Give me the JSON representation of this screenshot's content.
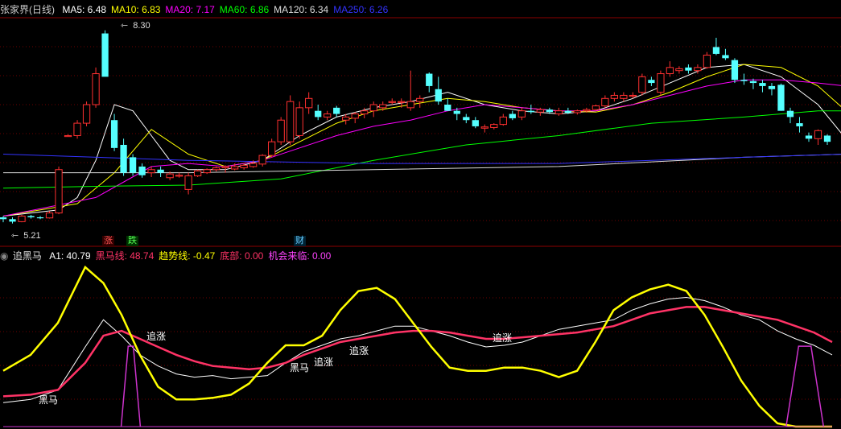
{
  "main_panel": {
    "title": "张家界(日线)",
    "indicators": [
      {
        "label": "MA5: 6.48",
        "color": "#ffffff"
      },
      {
        "label": "MA10: 6.83",
        "color": "#ffff00"
      },
      {
        "label": "MA20: 7.17",
        "color": "#ff00ff"
      },
      {
        "label": "MA60: 6.86",
        "color": "#00ff00"
      },
      {
        "label": "MA120: 6.34",
        "color": "#dddddd"
      },
      {
        "label": "MA250: 6.26",
        "color": "#3333ff"
      }
    ],
    "high_label": "8.30",
    "low_label": "5.21",
    "badges": [
      {
        "text": "涨",
        "color": "#ff5555",
        "bg": "#330000"
      },
      {
        "text": "跌",
        "color": "#55ff55",
        "bg": "#003300"
      },
      {
        "text": "财",
        "color": "#66ccff",
        "bg": "#002233"
      }
    ]
  },
  "sub_panel": {
    "title": "追黑马",
    "indicators": [
      {
        "label": "A1: 40.79",
        "color": "#ffffff"
      },
      {
        "label": "黑马线: 48.74",
        "color": "#ff3366"
      },
      {
        "label": "趋势线: -0.47",
        "color": "#ffff00"
      },
      {
        "label": "底部: 0.00",
        "color": "#ff3366"
      },
      {
        "label": "机会来临: 0.00",
        "color": "#ff44ff"
      }
    ],
    "annotations": [
      "黑马",
      "追涨",
      "黑马",
      "追涨",
      "追涨",
      "追涨"
    ]
  },
  "chart_data": [
    {
      "type": "candlestick",
      "ylim": [
        5.15,
        8.4
      ],
      "up_color": "#ff3030",
      "down_color": "#55ffff",
      "candles": [
        [
          5.28,
          5.3,
          5.2,
          5.25
        ],
        [
          5.25,
          5.28,
          5.18,
          5.21
        ],
        [
          5.21,
          5.32,
          5.2,
          5.3
        ],
        [
          5.3,
          5.32,
          5.26,
          5.28
        ],
        [
          5.28,
          5.3,
          5.25,
          5.27
        ],
        [
          5.27,
          5.38,
          5.26,
          5.35
        ],
        [
          5.35,
          6.1,
          5.33,
          6.05
        ],
        [
          6.6,
          6.62,
          6.58,
          6.6
        ],
        [
          6.6,
          6.85,
          6.55,
          6.8
        ],
        [
          6.8,
          7.15,
          6.75,
          7.1
        ],
        [
          7.1,
          7.7,
          7.05,
          7.6
        ],
        [
          8.25,
          8.3,
          7.85,
          7.55
        ],
        [
          6.85,
          6.95,
          6.35,
          6.4
        ],
        [
          6.45,
          6.55,
          5.95,
          6.0
        ],
        [
          6.25,
          6.3,
          5.95,
          6.0
        ],
        [
          6.1,
          6.15,
          5.92,
          5.96
        ],
        [
          6.0,
          6.1,
          5.93,
          6.05
        ],
        [
          6.05,
          6.1,
          5.93,
          6.0
        ],
        [
          5.92,
          6.02,
          5.88,
          5.98
        ],
        [
          5.96,
          6.0,
          5.92,
          5.96
        ],
        [
          5.73,
          6.0,
          5.65,
          5.95
        ],
        [
          5.95,
          6.05,
          5.93,
          6.03
        ],
        [
          6.0,
          6.07,
          5.98,
          6.05
        ],
        [
          6.05,
          6.1,
          6.02,
          6.08
        ],
        [
          6.08,
          6.12,
          6.0,
          6.1
        ],
        [
          6.06,
          6.15,
          6.04,
          6.1
        ],
        [
          6.08,
          6.15,
          6.05,
          6.12
        ],
        [
          6.1,
          6.2,
          6.08,
          6.15
        ],
        [
          6.14,
          6.3,
          6.1,
          6.28
        ],
        [
          6.28,
          6.55,
          6.25,
          6.5
        ],
        [
          6.5,
          6.9,
          6.45,
          6.85
        ],
        [
          6.5,
          7.25,
          6.45,
          7.15
        ],
        [
          6.6,
          7.15,
          6.55,
          7.05
        ],
        [
          7.05,
          7.3,
          6.95,
          7.2
        ],
        [
          7.0,
          7.1,
          6.85,
          6.9
        ],
        [
          6.9,
          7.0,
          6.85,
          6.95
        ],
        [
          7.05,
          7.08,
          6.9,
          6.95
        ],
        [
          6.85,
          6.95,
          6.78,
          6.9
        ],
        [
          6.88,
          6.98,
          6.8,
          6.95
        ],
        [
          6.95,
          7.05,
          6.88,
          7.0
        ],
        [
          7.0,
          7.15,
          6.9,
          7.1
        ],
        [
          7.05,
          7.15,
          7.0,
          7.1
        ],
        [
          7.15,
          7.2,
          7.1,
          7.15
        ],
        [
          7.15,
          7.2,
          7.05,
          7.15
        ],
        [
          7.05,
          7.65,
          7.0,
          7.15
        ],
        [
          7.15,
          7.25,
          7.05,
          7.2
        ],
        [
          7.6,
          7.62,
          7.3,
          7.4
        ],
        [
          7.35,
          7.55,
          7.1,
          7.15
        ],
        [
          7.1,
          7.2,
          7.0,
          7.0
        ],
        [
          7.0,
          7.05,
          6.85,
          6.95
        ],
        [
          6.9,
          6.95,
          6.8,
          6.85
        ],
        [
          6.85,
          6.9,
          6.72,
          6.75
        ],
        [
          6.72,
          6.78,
          6.65,
          6.74
        ],
        [
          6.73,
          6.8,
          6.7,
          6.78
        ],
        [
          6.78,
          6.95,
          6.76,
          6.9
        ],
        [
          6.95,
          7.0,
          6.85,
          6.88
        ],
        [
          6.9,
          7.05,
          6.85,
          7.0
        ],
        [
          7.0,
          7.1,
          6.95,
          6.98
        ],
        [
          6.98,
          7.05,
          6.92,
          7.02
        ],
        [
          7.02,
          7.05,
          6.95,
          6.98
        ],
        [
          6.95,
          7.05,
          6.92,
          7.0
        ],
        [
          7.0,
          7.05,
          6.95,
          6.97
        ],
        [
          6.97,
          7.02,
          6.94,
          7.0
        ],
        [
          7.0,
          7.05,
          6.97,
          7.02
        ],
        [
          7.02,
          7.1,
          7.0,
          7.08
        ],
        [
          7.08,
          7.25,
          7.05,
          7.2
        ],
        [
          7.2,
          7.3,
          7.15,
          7.25
        ],
        [
          7.2,
          7.3,
          7.15,
          7.25
        ],
        [
          7.25,
          7.3,
          7.2,
          7.25
        ],
        [
          7.3,
          7.6,
          7.25,
          7.55
        ],
        [
          7.5,
          7.55,
          7.4,
          7.45
        ],
        [
          7.3,
          7.65,
          7.25,
          7.6
        ],
        [
          7.6,
          7.8,
          7.55,
          7.7
        ],
        [
          7.65,
          7.72,
          7.6,
          7.68
        ],
        [
          7.7,
          7.75,
          7.6,
          7.65
        ],
        [
          7.65,
          7.75,
          7.6,
          7.7
        ],
        [
          7.7,
          7.95,
          7.68,
          7.9
        ],
        [
          8.03,
          8.18,
          7.9,
          7.92
        ],
        [
          7.9,
          8.0,
          7.82,
          7.85
        ],
        [
          7.82,
          7.85,
          7.45,
          7.5
        ],
        [
          7.5,
          7.6,
          7.42,
          7.48
        ],
        [
          7.48,
          7.52,
          7.35,
          7.45
        ],
        [
          7.45,
          7.5,
          7.3,
          7.4
        ],
        [
          7.4,
          7.45,
          7.25,
          7.35
        ],
        [
          7.42,
          7.44,
          7.0,
          7.0
        ],
        [
          7.0,
          7.05,
          6.8,
          6.9
        ],
        [
          6.8,
          6.9,
          6.65,
          6.75
        ],
        [
          6.6,
          6.65,
          6.5,
          6.55
        ],
        [
          6.55,
          6.7,
          6.45,
          6.68
        ],
        [
          6.6,
          6.62,
          6.45,
          6.5
        ]
      ],
      "ma_series": [
        {
          "name": "MA5",
          "color": "#ffffff",
          "x": [
            0,
            6,
            8,
            10,
            12,
            14,
            16,
            18,
            20,
            24,
            28,
            32,
            36,
            40,
            44,
            48,
            52,
            56,
            60,
            64,
            68,
            72,
            76,
            80,
            84,
            88,
            91
          ],
          "y": [
            5.3,
            5.4,
            5.6,
            6.2,
            7.1,
            7.0,
            6.6,
            6.2,
            6.05,
            6.05,
            6.2,
            6.6,
            6.9,
            7.05,
            7.15,
            7.3,
            7.1,
            7.0,
            6.95,
            7.0,
            7.2,
            7.45,
            7.7,
            7.75,
            7.55,
            7.1,
            6.55
          ]
        },
        {
          "name": "MA10",
          "color": "#ffff00",
          "x": [
            0,
            8,
            12,
            16,
            20,
            24,
            28,
            32,
            36,
            40,
            44,
            48,
            52,
            56,
            60,
            64,
            68,
            72,
            76,
            80,
            84,
            88,
            91
          ],
          "y": [
            5.3,
            5.5,
            6.0,
            6.7,
            6.3,
            6.1,
            6.2,
            6.5,
            6.8,
            7.0,
            7.1,
            7.2,
            7.15,
            7.05,
            7.0,
            6.98,
            7.1,
            7.3,
            7.55,
            7.75,
            7.7,
            7.4,
            7.0
          ]
        },
        {
          "name": "MA20",
          "color": "#ff00ff",
          "x": [
            0,
            10,
            16,
            20,
            24,
            28,
            32,
            36,
            40,
            44,
            48,
            52,
            56,
            60,
            64,
            68,
            72,
            76,
            80,
            84,
            88,
            91
          ],
          "y": [
            5.3,
            5.6,
            6.1,
            6.15,
            6.1,
            6.2,
            6.4,
            6.6,
            6.75,
            6.85,
            7.0,
            7.1,
            7.05,
            7.0,
            7.0,
            7.1,
            7.25,
            7.4,
            7.5,
            7.5,
            7.45,
            7.4
          ]
        },
        {
          "name": "MA60",
          "color": "#00ff00",
          "x": [
            0,
            10,
            20,
            30,
            40,
            50,
            60,
            70,
            80,
            88,
            91
          ],
          "y": [
            5.75,
            5.78,
            5.8,
            5.9,
            6.2,
            6.45,
            6.6,
            6.8,
            6.9,
            7.0,
            7.0
          ]
        },
        {
          "name": "MA120",
          "color": "#dddddd",
          "x": [
            0,
            20,
            40,
            60,
            80,
            91
          ],
          "y": [
            6.0,
            6.0,
            6.05,
            6.1,
            6.25,
            6.3
          ]
        },
        {
          "name": "MA250",
          "color": "#3333ff",
          "x": [
            0,
            20,
            40,
            60,
            80,
            91
          ],
          "y": [
            6.3,
            6.2,
            6.15,
            6.15,
            6.25,
            6.3
          ]
        }
      ]
    },
    {
      "type": "line",
      "ylim": [
        -5,
        100
      ],
      "x": [
        0,
        3,
        6,
        9,
        11,
        13,
        15,
        17,
        19,
        21,
        23,
        25,
        27,
        29,
        31,
        33,
        35,
        37,
        39,
        41,
        43,
        45,
        47,
        49,
        51,
        53,
        55,
        57,
        59,
        61,
        63,
        65,
        67,
        69,
        71,
        73,
        75,
        77,
        79,
        81,
        83,
        85,
        87,
        89,
        91
      ],
      "series": [
        {
          "name": "A1",
          "color": "#ffffff",
          "y": [
            10,
            12,
            18,
            45,
            62,
            52,
            40,
            33,
            28,
            26,
            27,
            25,
            26,
            27,
            35,
            42,
            46,
            50,
            52,
            55,
            58,
            58,
            55,
            52,
            48,
            45,
            46,
            48,
            52,
            56,
            58,
            60,
            62,
            68,
            72,
            75,
            76,
            74,
            70,
            65,
            62,
            55,
            50,
            46,
            40
          ]
        },
        {
          "name": "黑马线",
          "color": "#ff3366",
          "y": [
            14,
            15,
            18,
            35,
            52,
            55,
            50,
            45,
            40,
            36,
            33,
            32,
            31,
            32,
            35,
            40,
            44,
            48,
            50,
            52,
            54,
            55,
            55,
            54,
            52,
            50,
            50,
            51,
            52,
            53,
            54,
            56,
            58,
            62,
            66,
            68,
            70,
            70,
            68,
            66,
            64,
            62,
            58,
            54,
            48
          ]
        },
        {
          "name": "趋势线",
          "color": "#ffff00",
          "y": [
            30,
            40,
            60,
            95,
            85,
            65,
            40,
            20,
            12,
            12,
            13,
            15,
            22,
            35,
            46,
            46,
            52,
            68,
            80,
            82,
            75,
            60,
            45,
            32,
            30,
            30,
            32,
            32,
            30,
            26,
            30,
            48,
            68,
            76,
            81,
            84,
            80,
            65,
            45,
            24,
            8,
            -3,
            -5,
            -5,
            -5
          ]
        },
        {
          "name": "机会来临",
          "color": "#cc33cc",
          "y": [
            -5,
            -5,
            -5,
            -5,
            -5,
            -5,
            -5,
            -5,
            -5,
            -5,
            -5,
            -5,
            -5,
            -5,
            -5,
            -5,
            -5,
            -5,
            -5,
            -5,
            -5,
            -5,
            -5,
            -5,
            -5,
            -5,
            -5,
            -5,
            -5,
            -5,
            -5,
            -5,
            -5,
            -5,
            -5,
            -5,
            -5,
            -5,
            -5,
            -5,
            -5,
            -5,
            -5,
            -5,
            -5
          ]
        }
      ],
      "pulses": [
        {
          "x0": 13.3,
          "x1": 14.7,
          "height": 12
        },
        {
          "x0": 86.3,
          "x1": 89.7,
          "height": 12
        }
      ]
    }
  ]
}
